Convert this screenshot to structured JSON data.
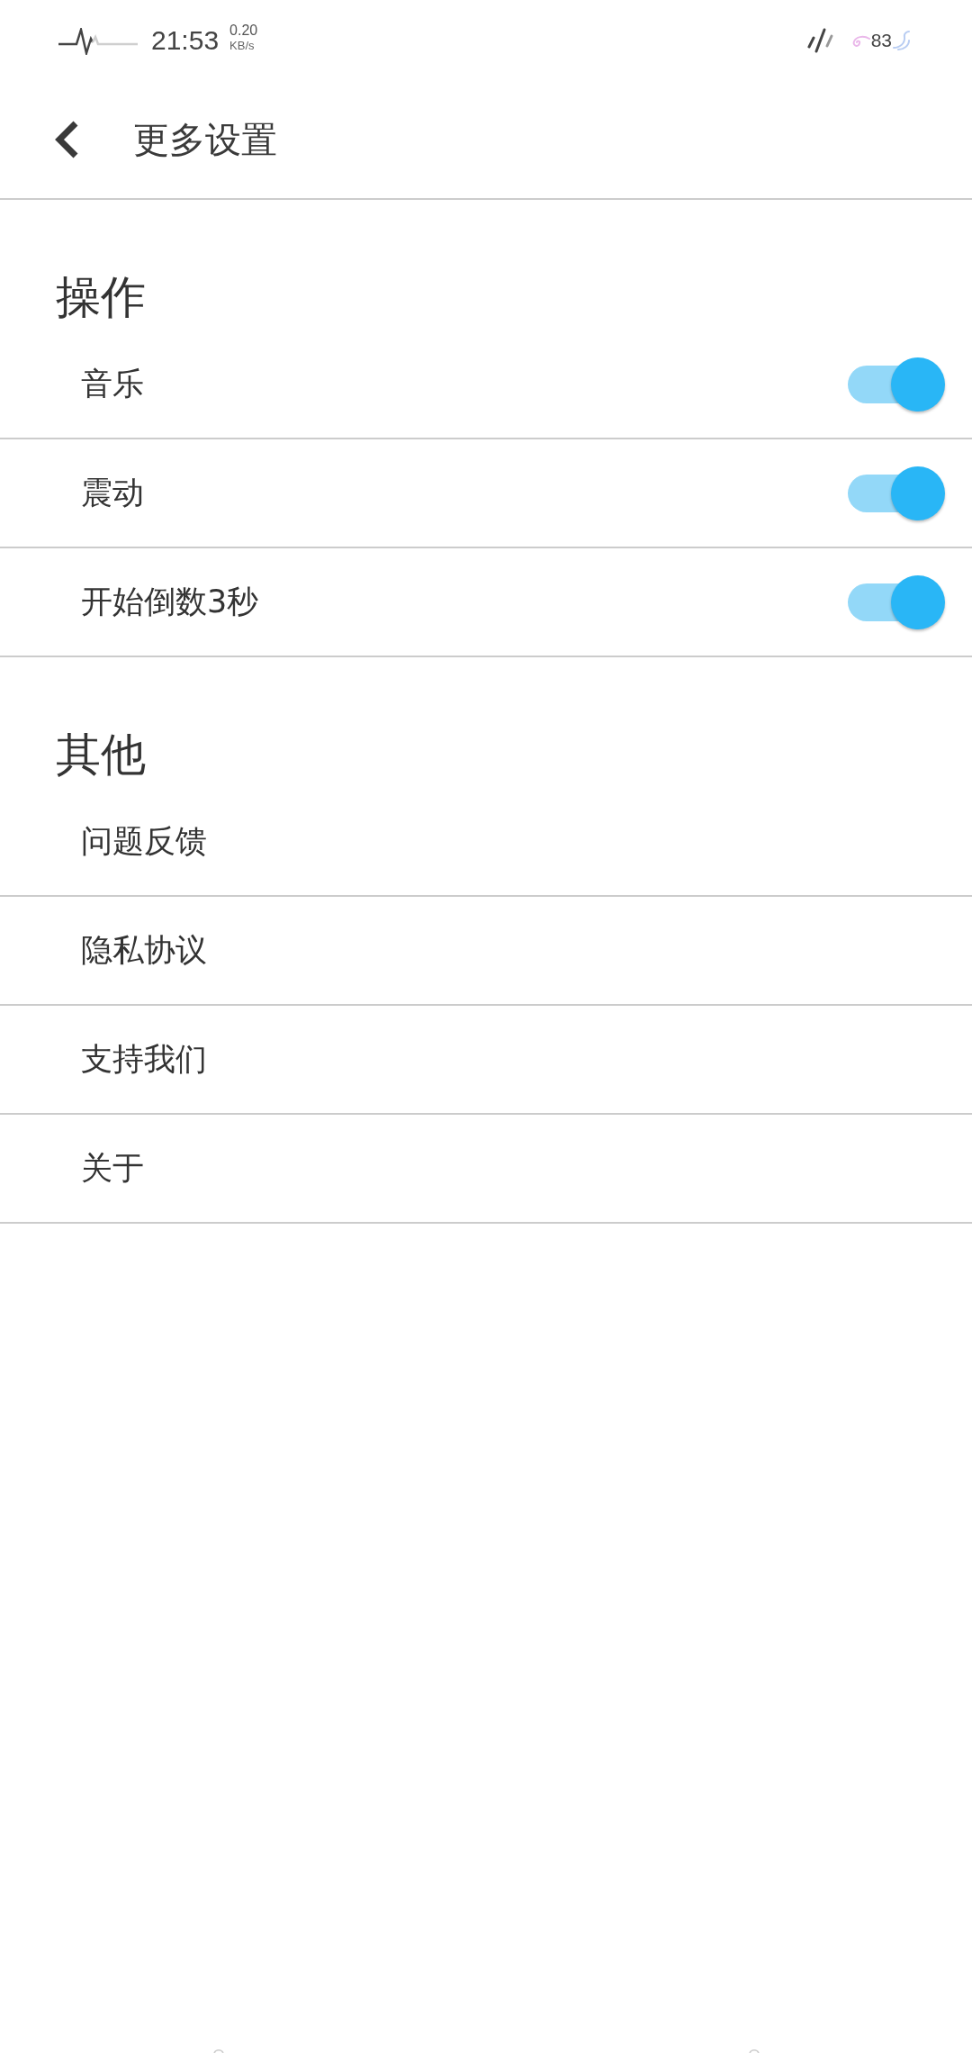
{
  "status_bar": {
    "time": "21:53",
    "net_speed": {
      "value": "0.20",
      "unit": "KB/s"
    },
    "battery": "83"
  },
  "header": {
    "title": "更多设置"
  },
  "sections": [
    {
      "title": "操作",
      "items": [
        {
          "label": "音乐",
          "kind": "switch",
          "on": true
        },
        {
          "label": "震动",
          "kind": "switch",
          "on": true
        },
        {
          "label": "开始倒数3秒",
          "kind": "switch",
          "on": true
        }
      ]
    },
    {
      "title": "其他",
      "items": [
        {
          "label": "问题反馈",
          "kind": "link"
        },
        {
          "label": "隐私协议",
          "kind": "link"
        },
        {
          "label": "支持我们",
          "kind": "link"
        },
        {
          "label": "关于",
          "kind": "link"
        }
      ]
    }
  ]
}
